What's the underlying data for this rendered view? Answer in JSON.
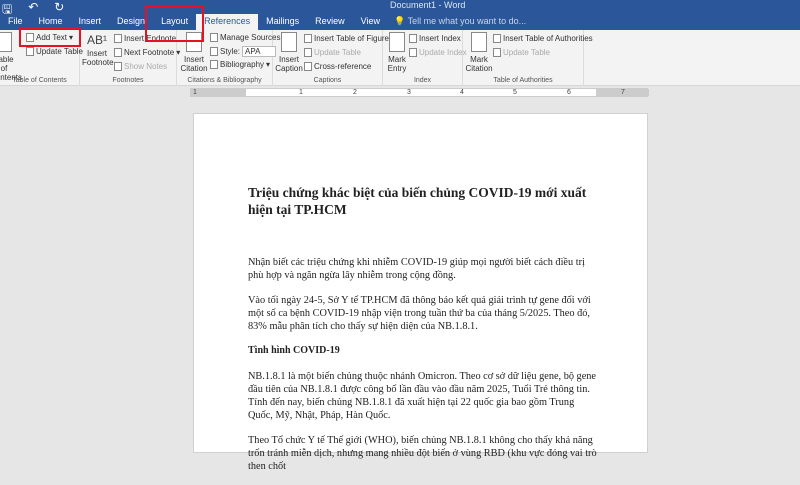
{
  "window": {
    "title": "Document1 - Word"
  },
  "tabs": [
    "File",
    "Home",
    "Insert",
    "Design",
    "Layout",
    "References",
    "Mailings",
    "Review",
    "View"
  ],
  "tell_me": "Tell me what you want to do...",
  "ribbon": {
    "toc": {
      "big": "Table of Contents",
      "add_text": "Add Text",
      "update_table": "Update Table",
      "label": "Table of Contents"
    },
    "footnotes": {
      "big": "Insert Footnote",
      "insert_endnote": "Insert Endnote",
      "next_footnote": "Next Footnote",
      "show_notes": "Show Notes",
      "label": "Footnotes"
    },
    "citations": {
      "big": "Insert Citation",
      "manage_sources": "Manage Sources",
      "style_label": "Style:",
      "style_value": "APA",
      "bibliography": "Bibliography",
      "label": "Citations & Bibliography"
    },
    "captions": {
      "big": "Insert Caption",
      "insert_tof": "Insert Table of Figures",
      "update_table": "Update Table",
      "cross_ref": "Cross-reference",
      "label": "Captions"
    },
    "index": {
      "big": "Mark Entry",
      "insert_index": "Insert Index",
      "update_index": "Update Index",
      "label": "Index"
    },
    "toa": {
      "big": "Mark Citation",
      "insert_toa": "Insert Table of Authorities",
      "update_table": "Update Table",
      "label": "Table of Authorities"
    }
  },
  "ruler": [
    "1",
    "1",
    "2",
    "3",
    "4",
    "5",
    "6",
    "7"
  ],
  "document": {
    "title": "Triệu chứng khác biệt của biến chủng COVID-19 mới xuất hiện tại TP.HCM",
    "p1": "Nhận biết các triệu chứng khi nhiễm COVID-19 giúp mọi người biết cách điều trị phù hợp và ngăn ngừa lây nhiễm trong cộng đồng.",
    "p2": "Vào tối ngày 24-5, Sở Y tế TP.HCM đã thông báo kết quả giải trình tự gene đối với một số ca bệnh COVID-19 nhập viện trong tuần thứ ba của tháng 5/2025. Theo đó, 83% mẫu phân tích cho thấy sự hiện diện của NB.1.8.1.",
    "h2": "Tình hình COVID-19",
    "p3": "NB.1.8.1 là một biến chủng thuộc nhánh Omicron. Theo cơ sở dữ liệu gene, bộ gene đầu tiên của NB.1.8.1 được công bố lần đầu vào đầu năm 2025, Tuổi Trẻ thông tin. Tính đến nay, biến chủng NB.1.8.1 đã xuất hiện tại 22 quốc gia bao gồm Trung Quốc, Mỹ, Nhật, Pháp, Hàn Quốc.",
    "p4": "Theo Tổ chức Y tế Thế giới (WHO), biến chủng NB.1.8.1 không cho thấy khả năng trốn tránh miễn dịch, nhưng mang nhiều đột biến ở vùng RBD (khu vực đóng vai trò then chốt"
  }
}
